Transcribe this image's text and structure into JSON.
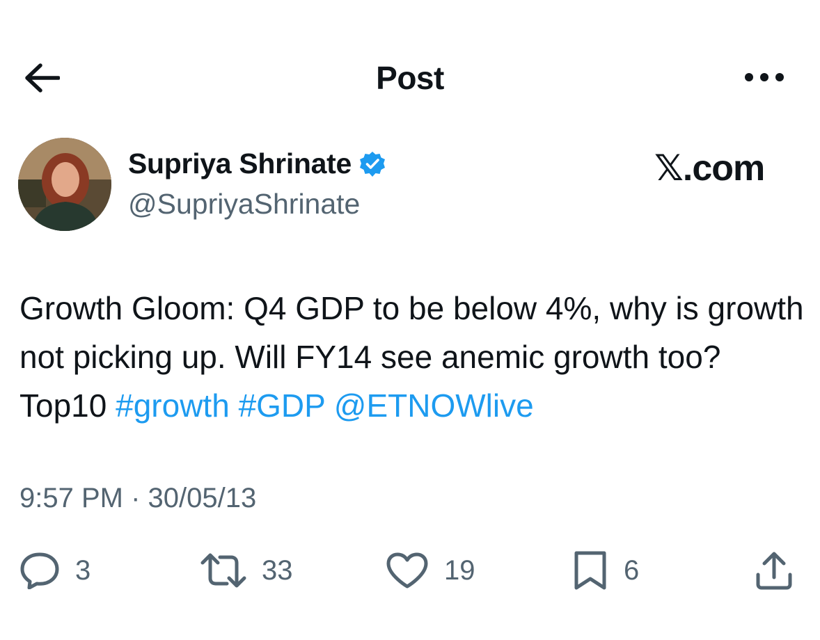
{
  "header": {
    "title": "Post"
  },
  "author": {
    "name": "Supriya Shrinate",
    "handle": "@SupriyaShrinate",
    "verified": true,
    "verified_color": "#1d9bf0"
  },
  "watermark": "𝕏.com",
  "tweet": {
    "text_plain": "Growth Gloom: Q4 GDP to be below 4%, why is growth not picking up. Will FY14 see anemic growth too? Top10 ",
    "link_1": "#growth",
    "link_2": "#GDP",
    "link_3": "@ETNOWlive",
    "link_color": "#1d9bf0"
  },
  "timestamp": "9:57 PM · 30/05/13",
  "actions": {
    "replies": "3",
    "reposts": "33",
    "likes": "19",
    "bookmarks": "6"
  },
  "icons": {
    "back": "arrow-left-icon",
    "more": "more-horizontal-icon",
    "reply": "reply-bubble-icon",
    "repost": "repost-icon",
    "like": "heart-icon",
    "bookmark": "bookmark-icon",
    "share": "share-upload-icon"
  }
}
